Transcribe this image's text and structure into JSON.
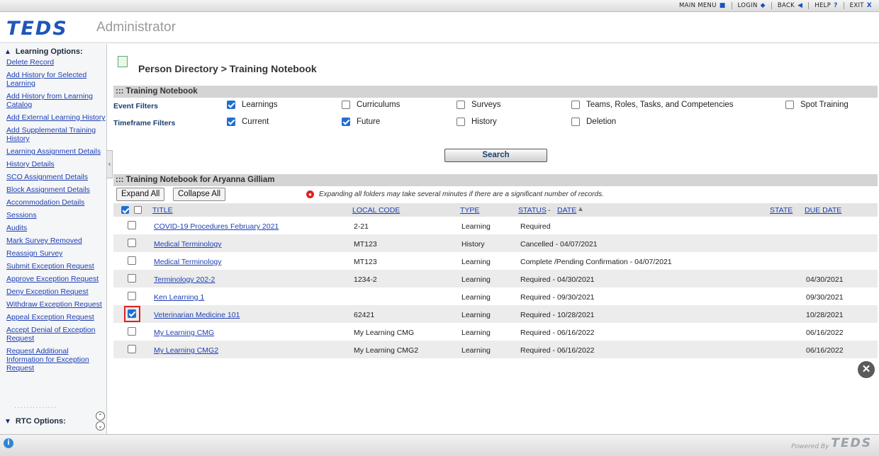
{
  "topnav": [
    {
      "label": "MAIN MENU",
      "icon": "■"
    },
    {
      "label": "LOGIN",
      "icon": "◆"
    },
    {
      "label": "BACK",
      "icon": "◀"
    },
    {
      "label": "HELP",
      "icon": "?"
    },
    {
      "label": "EXIT",
      "icon": "X"
    }
  ],
  "header": {
    "logo": "TEDS",
    "app_name": "Administrator"
  },
  "sidebar": {
    "section_title": "Learning Options:",
    "links": [
      "Delete Record",
      "Add History for Selected Learning",
      "Add History from Learning Catalog",
      "Add External Learning History",
      "Add Supplemental Training History",
      "Learning Assignment Details",
      "History Details",
      "SCO Assignment Details",
      "Block Assignment Details",
      "Accommodation Details",
      "Sessions",
      "Audits",
      "Mark Survey Removed",
      "Reassign Survey",
      "Submit Exception Request",
      "Approve Exception Request",
      "Deny Exception Request",
      "Withdraw Exception Request",
      "Appeal Exception Request",
      "Accept Denial of Exception Request",
      "Request Additional Information for Exception Request"
    ],
    "rtc_title": "RTC Options:"
  },
  "main": {
    "breadcrumb": "Person Directory > Training Notebook",
    "section1": "::: Training Notebook",
    "event_filters_label": "Event Filters",
    "timeframe_filters_label": "Timeframe Filters",
    "event_filters": [
      {
        "label": "Learnings",
        "checked": true
      },
      {
        "label": "Curriculums",
        "checked": false
      },
      {
        "label": "Surveys",
        "checked": false
      },
      {
        "label": "Teams, Roles, Tasks, and Competencies",
        "checked": false
      },
      {
        "label": "Spot Training",
        "checked": false
      }
    ],
    "timeframe_filters": [
      {
        "label": "Current",
        "checked": true
      },
      {
        "label": "Future",
        "checked": true
      },
      {
        "label": "History",
        "checked": false
      },
      {
        "label": "Deletion",
        "checked": false
      }
    ],
    "search_label": "Search",
    "section2": "::: Training Notebook for Aryanna Gilliam",
    "expand_all": "Expand All",
    "collapse_all": "Collapse All",
    "warning": "Expanding all folders may take several minutes if there are a significant number of records.",
    "columns": {
      "title": "TITLE",
      "local_code": "LOCAL CODE",
      "type": "TYPE",
      "status": "STATUS",
      "date": "DATE",
      "state": "STATE",
      "due_date": "DUE DATE"
    },
    "rows": [
      {
        "title": "COVID-19 Procedures February 2021",
        "local_code": "2-21",
        "type": "Learning",
        "status": "Required",
        "state": "",
        "due_date": "",
        "checked": false
      },
      {
        "title": "Medical Terminology",
        "local_code": "MT123",
        "type": "History",
        "status": "Cancelled  - 04/07/2021",
        "state": "",
        "due_date": "",
        "checked": false
      },
      {
        "title": "Medical Terminology",
        "local_code": "MT123",
        "type": "Learning",
        "status": "Complete /Pending Confirmation  - 04/07/2021",
        "state": "",
        "due_date": "",
        "checked": false
      },
      {
        "title": "Terminology 202-2",
        "local_code": "1234-2",
        "type": "Learning",
        "status": "Required  - 04/30/2021",
        "state": "",
        "due_date": "04/30/2021",
        "checked": false
      },
      {
        "title": "Ken Learning 1",
        "local_code": "",
        "type": "Learning",
        "status": "Required  - 09/30/2021",
        "state": "",
        "due_date": "09/30/2021",
        "checked": false
      },
      {
        "title": "Veterinarian Medicine 101",
        "local_code": "62421",
        "type": "Learning",
        "status": "Required  - 10/28/2021",
        "state": "",
        "due_date": "10/28/2021",
        "checked": true
      },
      {
        "title": "My Learning CMG",
        "local_code": "My Learning CMG",
        "type": "Learning",
        "status": "Required  - 06/16/2022",
        "state": "",
        "due_date": "06/16/2022",
        "checked": false
      },
      {
        "title": "My Learning CMG2",
        "local_code": "My Learning CMG2",
        "type": "Learning",
        "status": "Required  - 06/16/2022",
        "state": "",
        "due_date": "06/16/2022",
        "checked": false
      }
    ]
  },
  "footer": {
    "powered_by": "Powered By",
    "logo": "TEDS"
  },
  "colors": {
    "link": "#1d3fb3",
    "brand": "#1f56b8",
    "check": "#1f6fd1",
    "highlight": "#dd2222"
  }
}
